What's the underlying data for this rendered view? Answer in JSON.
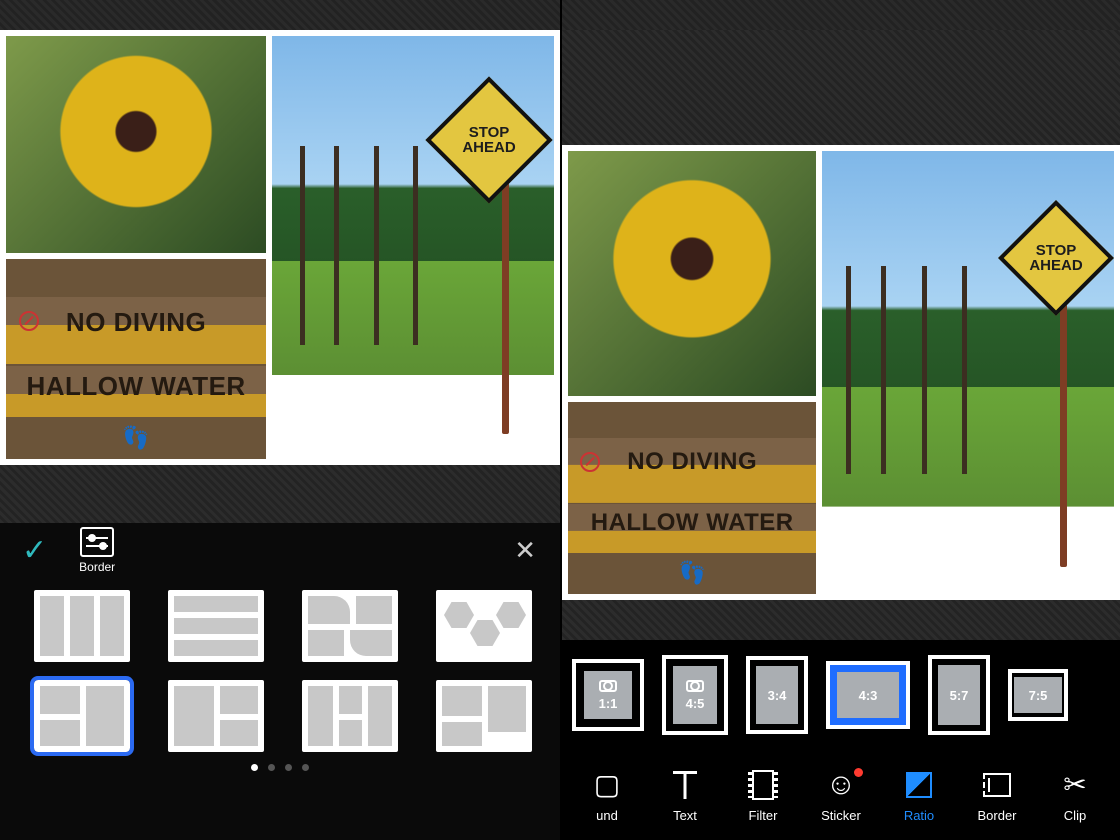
{
  "left": {
    "header": {
      "border_label": "Border"
    },
    "photos": {
      "sign_line1": "NO DIVING",
      "sign_line2": "HALLOW WATER",
      "road_sign": "STOP\nAHEAD"
    },
    "layouts": [
      "l1",
      "l2",
      "l3",
      "l4",
      "l5",
      "l6",
      "l7",
      "l8"
    ],
    "selected_layout": "l5",
    "page_dots": 4,
    "active_dot": 0
  },
  "right": {
    "photos": {
      "sign_line1": "NO DIVING",
      "sign_line2": "HALLOW WATER",
      "road_sign": "STOP\nAHEAD"
    },
    "ratios": [
      {
        "id": "1:1",
        "label": "1:1",
        "cls": "r-11",
        "icon": true
      },
      {
        "id": "4:5",
        "label": "4:5",
        "cls": "r-45",
        "icon": true
      },
      {
        "id": "3:4",
        "label": "3:4",
        "cls": "r-34",
        "icon": false
      },
      {
        "id": "4:3",
        "label": "4:3",
        "cls": "r-43",
        "icon": false,
        "selected": true
      },
      {
        "id": "5:7",
        "label": "5:7",
        "cls": "r-57",
        "icon": false
      },
      {
        "id": "7:5",
        "label": "7:5",
        "cls": "r-75",
        "icon": false
      }
    ],
    "toolbar": [
      {
        "id": "background",
        "label": "und",
        "icon": "square"
      },
      {
        "id": "text",
        "label": "Text",
        "icon": "text"
      },
      {
        "id": "filter",
        "label": "Filter",
        "icon": "film"
      },
      {
        "id": "sticker",
        "label": "Sticker",
        "icon": "smile",
        "badge": true
      },
      {
        "id": "ratio",
        "label": "Ratio",
        "icon": "ratio",
        "active": true
      },
      {
        "id": "border",
        "label": "Border",
        "icon": "border"
      },
      {
        "id": "clip",
        "label": "Clip",
        "icon": "scissors"
      }
    ]
  }
}
